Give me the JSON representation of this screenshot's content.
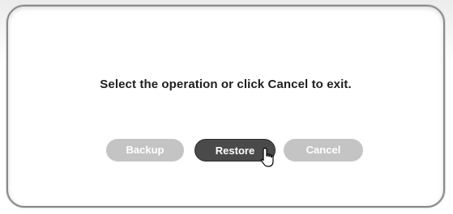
{
  "dialog": {
    "message": "Select the operation or click Cancel to exit.",
    "buttons": {
      "backup_label": "Backup",
      "restore_label": "Restore",
      "cancel_label": "Cancel"
    }
  },
  "colors": {
    "button_inactive": "#c4c4c4",
    "button_active": "#4a4a4a",
    "frame_border": "#8a8a8a",
    "text": "#1e1e1e"
  },
  "cursor": {
    "icon": "hand-pointer-icon"
  }
}
